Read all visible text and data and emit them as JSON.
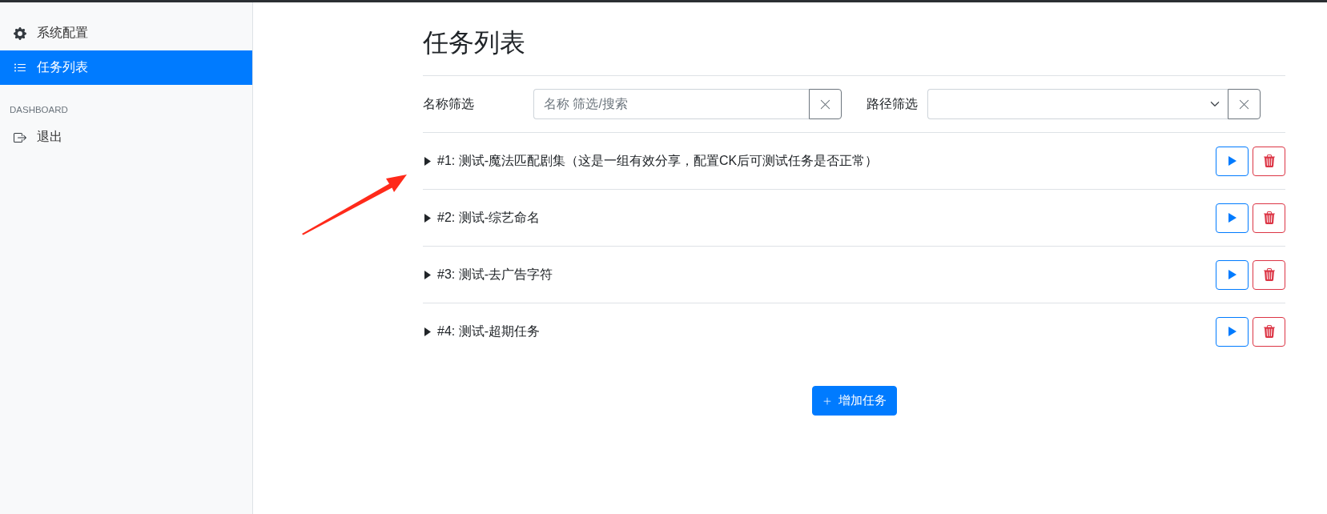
{
  "sidebar": {
    "items": [
      {
        "label": "系统配置",
        "selected": false
      },
      {
        "label": "任务列表",
        "selected": true
      }
    ],
    "sections": [
      {
        "heading": "DASHBOARD",
        "items": [
          {
            "label": "退出",
            "selected": false
          }
        ]
      }
    ]
  },
  "page": {
    "title": "任务列表"
  },
  "filters": [
    {
      "kind": "text",
      "label": "名称筛选",
      "placeholder": "名称 筛选/搜索"
    },
    {
      "kind": "select",
      "label": "路径筛选"
    }
  ],
  "tasks": [
    {
      "label": "#1: 测试-魔法匹配剧集（这是一组有效分享，配置CK后可测试任务是否正常）",
      "expanded": false
    },
    {
      "label": "#2: 测试-综艺命名",
      "expanded": false
    },
    {
      "label": "#3: 测试-去广告字符",
      "expanded": false
    },
    {
      "label": "#4: 测试-超期任务",
      "expanded": false
    }
  ],
  "add_button": {
    "label": "增加任务"
  }
}
